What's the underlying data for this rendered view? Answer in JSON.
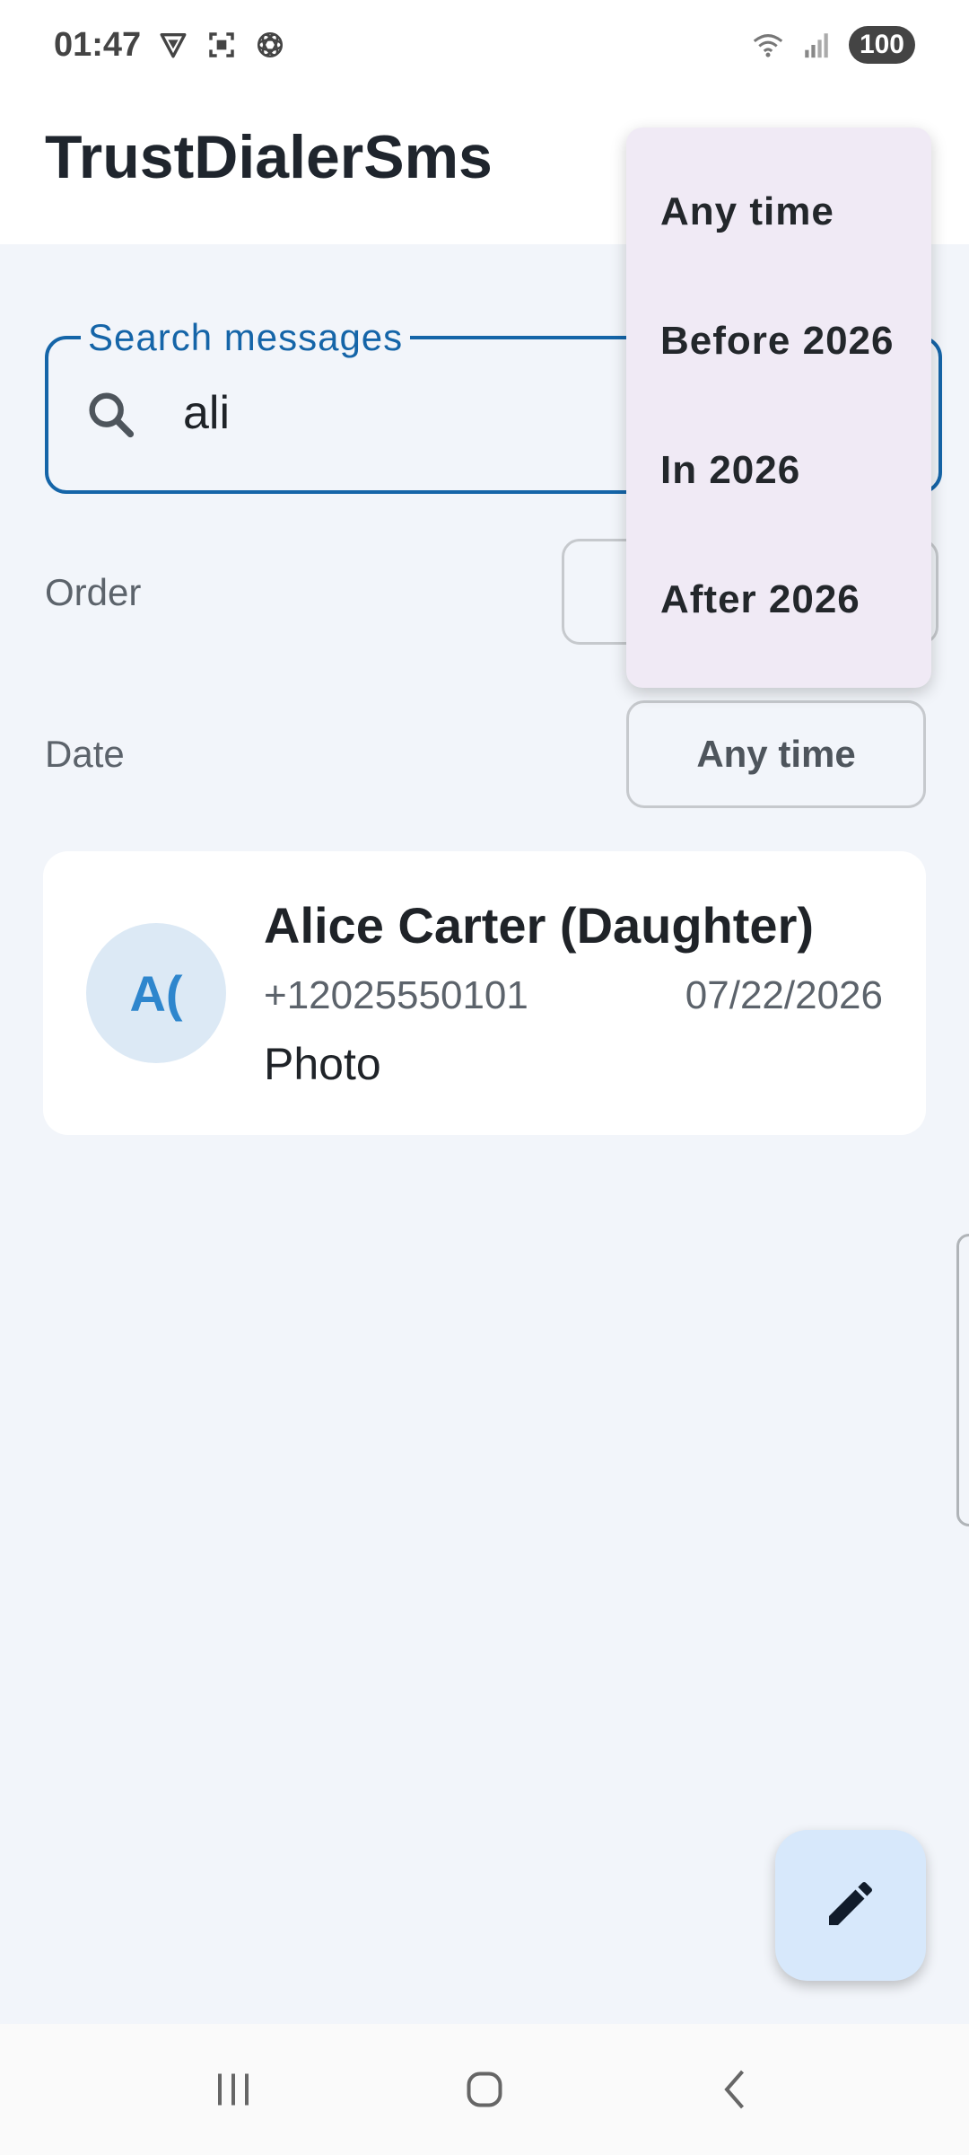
{
  "status_bar": {
    "time": "01:47",
    "battery": "100",
    "left_icons": [
      "vpn-shield-icon",
      "screenshot-icon",
      "openai-icon"
    ],
    "right_icons": [
      "wifi-icon",
      "signal-icon",
      "battery-icon"
    ]
  },
  "app": {
    "title": "TrustDialerSms"
  },
  "search": {
    "label": "Search messages",
    "value": "ali"
  },
  "filters": {
    "order_label": "Order",
    "date_label": "Date",
    "date_value": "Any time"
  },
  "results": [
    {
      "avatar_initials": "A(",
      "name": "Alice Carter (Daughter)",
      "number": "+12025550101",
      "date": "07/22/2026",
      "preview": "Photo"
    }
  ],
  "date_menu": {
    "options": [
      "Any time",
      "Before 2026",
      "In 2026",
      "After 2026"
    ]
  },
  "fab": {
    "icon": "edit-pencil-icon"
  },
  "colors": {
    "accent": "#1565a8",
    "background": "#f2f5fa",
    "avatar_bg": "#dce9f5",
    "avatar_fg": "#2e86cd",
    "menu_bg": "#f0eaf5",
    "fab_bg": "#d7e8fb"
  }
}
